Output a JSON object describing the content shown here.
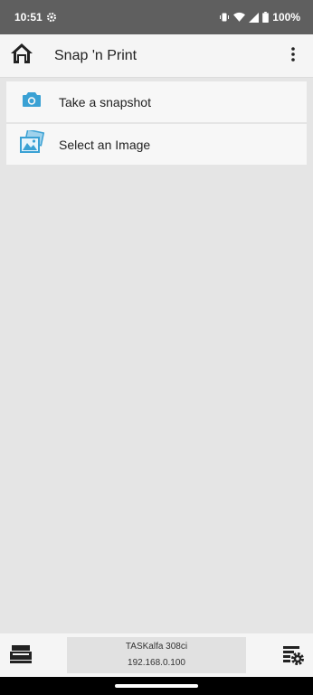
{
  "status_bar": {
    "time": "10:51",
    "battery": "100%"
  },
  "app_bar": {
    "title": "Snap 'n Print"
  },
  "menu": {
    "items": [
      {
        "label": "Take a snapshot",
        "icon": "camera-icon"
      },
      {
        "label": "Select an Image",
        "icon": "image-gallery-icon"
      }
    ]
  },
  "printer": {
    "model": "TASKalfa 308ci",
    "ip": "192.168.0.100"
  },
  "colors": {
    "accent": "#3aa1d4",
    "status_bar": "#5f5f5f",
    "background": "#e5e5e5"
  }
}
